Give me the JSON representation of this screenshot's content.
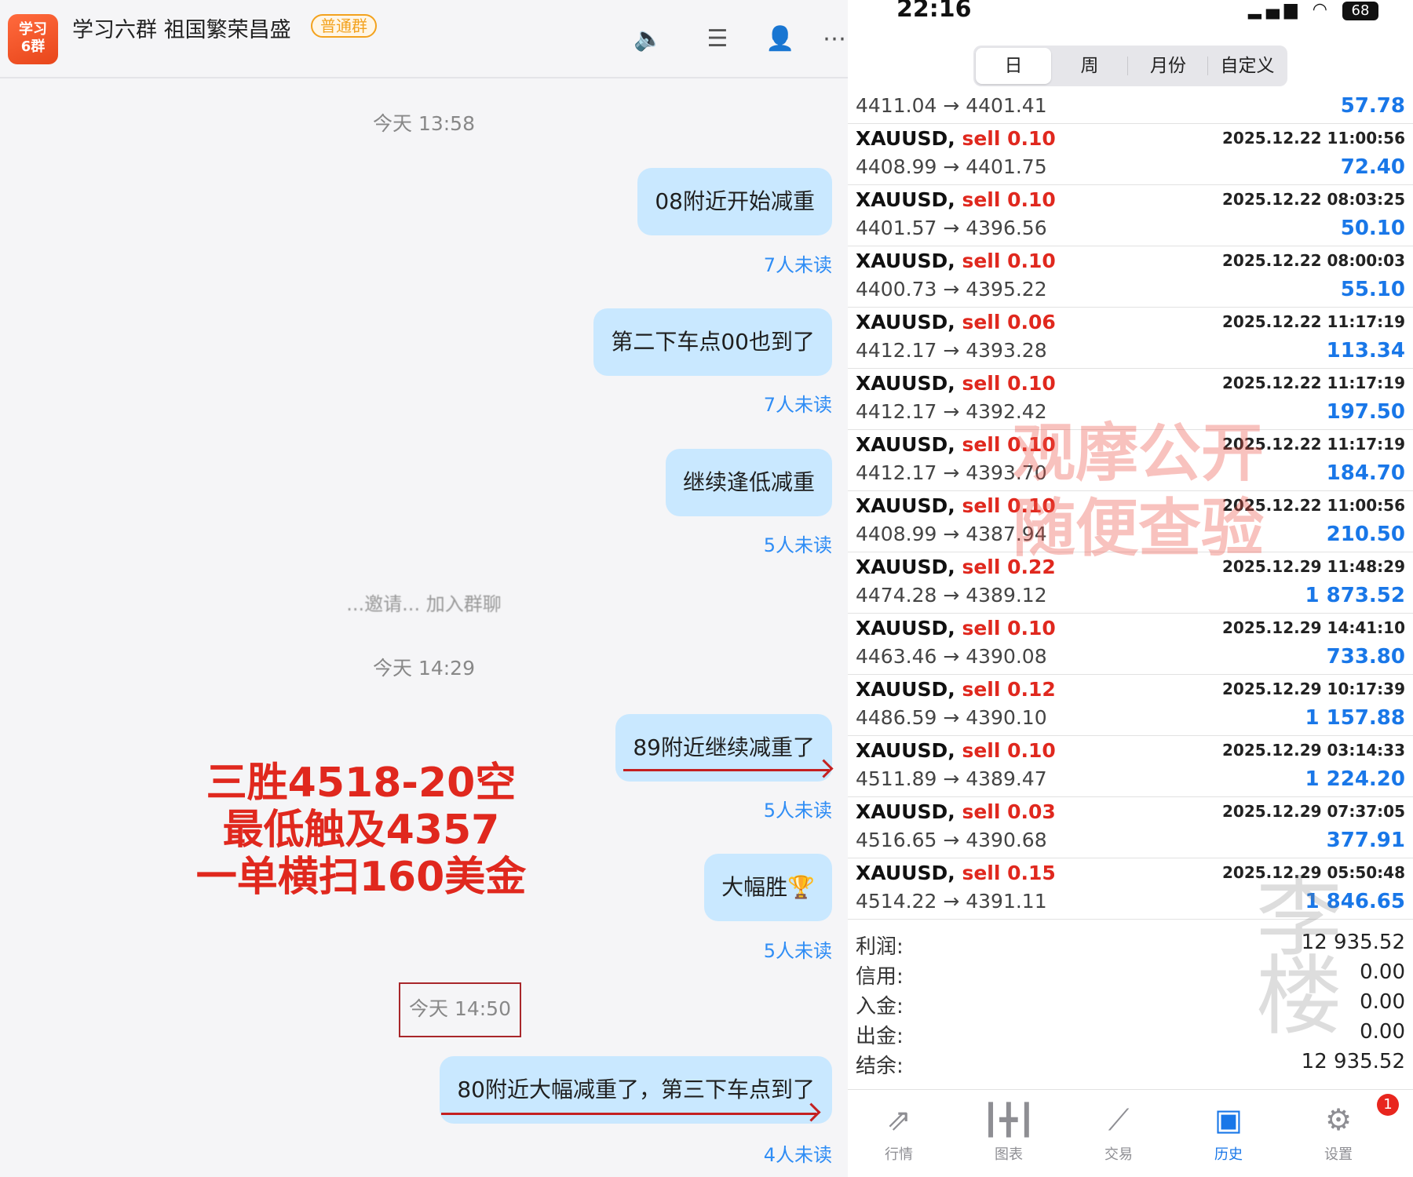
{
  "chat": {
    "avatar_line1": "学习",
    "avatar_line2": "6群",
    "group_title": "学习六群 祖国繁荣昌盛",
    "group_badge": "普通群",
    "header_icons": [
      "speaker-icon",
      "search-list-icon",
      "add-user-icon",
      "more-icon"
    ],
    "timestamps": [
      "今天 13:58",
      "今天 14:29",
      "今天 14:50"
    ],
    "messages": [
      {
        "text": "08附近开始减重",
        "unread": "7人未读"
      },
      {
        "text": "第二下车点00也到了",
        "unread": "7人未读"
      },
      {
        "text": "继续逢低减重",
        "unread": "5人未读"
      },
      {
        "text": "89附近继续减重了",
        "unread": "5人未读"
      },
      {
        "text": "大幅胜🏆",
        "unread": "5人未读"
      },
      {
        "text": "80附近大幅减重了，第三下车点到了",
        "unread": "4人未读"
      }
    ],
    "system_message": "...邀请... 加入群聊",
    "overlay_lines": [
      "三胜4518-20空",
      "最低触及4357",
      "一单横扫160美金"
    ],
    "accent_color": "#e0281e",
    "bubble_color": "#c9e8ff"
  },
  "history": {
    "status_time": "22:16",
    "battery": "68",
    "tabs": [
      "日",
      "周",
      "月份",
      "自定义"
    ],
    "active_tab": "日",
    "partial_top": {
      "prices": "4411.04 → 4401.41",
      "profit": "57.78"
    },
    "trades": [
      {
        "symbol": "XAUUSD,",
        "side": "sell 0.10",
        "date": "2025.12.22 11:00:56",
        "prices": "4408.99 → 4401.75",
        "profit": "72.40"
      },
      {
        "symbol": "XAUUSD,",
        "side": "sell 0.10",
        "date": "2025.12.22 08:03:25",
        "prices": "4401.57 → 4396.56",
        "profit": "50.10"
      },
      {
        "symbol": "XAUUSD,",
        "side": "sell 0.10",
        "date": "2025.12.22 08:00:03",
        "prices": "4400.73 → 4395.22",
        "profit": "55.10"
      },
      {
        "symbol": "XAUUSD,",
        "side": "sell 0.06",
        "date": "2025.12.22 11:17:19",
        "prices": "4412.17 → 4393.28",
        "profit": "113.34"
      },
      {
        "symbol": "XAUUSD,",
        "side": "sell 0.10",
        "date": "2025.12.22 11:17:19",
        "prices": "4412.17 → 4392.42",
        "profit": "197.50"
      },
      {
        "symbol": "XAUUSD,",
        "side": "sell 0.10",
        "date": "2025.12.22 11:17:19",
        "prices": "4412.17 → 4393.70",
        "profit": "184.70"
      },
      {
        "symbol": "XAUUSD,",
        "side": "sell 0.10",
        "date": "2025.12.22 11:00:56",
        "prices": "4408.99 → 4387.94",
        "profit": "210.50"
      },
      {
        "symbol": "XAUUSD,",
        "side": "sell 0.22",
        "date": "2025.12.29 11:48:29",
        "prices": "4474.28 → 4389.12",
        "profit": "1 873.52"
      },
      {
        "symbol": "XAUUSD,",
        "side": "sell 0.10",
        "date": "2025.12.29 14:41:10",
        "prices": "4463.46 → 4390.08",
        "profit": "733.80"
      },
      {
        "symbol": "XAUUSD,",
        "side": "sell 0.12",
        "date": "2025.12.29 10:17:39",
        "prices": "4486.59 → 4390.10",
        "profit": "1 157.88"
      },
      {
        "symbol": "XAUUSD,",
        "side": "sell 0.10",
        "date": "2025.12.29 03:14:33",
        "prices": "4511.89 → 4389.47",
        "profit": "1 224.20"
      },
      {
        "symbol": "XAUUSD,",
        "side": "sell 0.03",
        "date": "2025.12.29 07:37:05",
        "prices": "4516.65 → 4390.68",
        "profit": "377.91"
      },
      {
        "symbol": "XAUUSD,",
        "side": "sell 0.15",
        "date": "2025.12.29 05:50:48",
        "prices": "4514.22 → 4391.11",
        "profit": "1 846.65"
      }
    ],
    "watermark_lines": [
      "观摩公开",
      "随便查验"
    ],
    "signature_mark": "李楼",
    "summary": [
      {
        "label": "利润:",
        "value": "12 935.52"
      },
      {
        "label": "信用:",
        "value": "0.00"
      },
      {
        "label": "入金:",
        "value": "0.00"
      },
      {
        "label": "出金:",
        "value": "0.00"
      },
      {
        "label": "结余:",
        "value": "12 935.52"
      }
    ],
    "nav": [
      {
        "label": "行情",
        "icon": "quotes-icon",
        "glyph": "⇗"
      },
      {
        "label": "图表",
        "icon": "chart-icon",
        "glyph": "┃╋┃"
      },
      {
        "label": "交易",
        "icon": "trade-icon",
        "glyph": "⟋"
      },
      {
        "label": "历史",
        "icon": "history-icon",
        "glyph": "▣"
      },
      {
        "label": "设置",
        "icon": "settings-icon",
        "glyph": "⚙"
      }
    ],
    "active_nav": "历史",
    "settings_badge": "1",
    "colors": {
      "sell": "#e0281e",
      "profit": "#1977e8"
    }
  }
}
